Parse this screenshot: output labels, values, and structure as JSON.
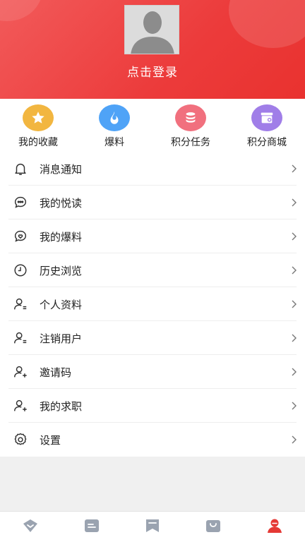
{
  "header": {
    "login_label": "点击登录",
    "bg_color": "#ec3b3b"
  },
  "quick_entries": [
    {
      "label": "我的收藏",
      "icon": "star-icon",
      "color": "#f0b33b"
    },
    {
      "label": "爆料",
      "icon": "flame-icon",
      "color": "#4a9ff5"
    },
    {
      "label": "积分任务",
      "icon": "coins-icon",
      "color": "#f16b7a"
    },
    {
      "label": "积分商城",
      "icon": "shop-icon",
      "color": "#9c7ce8"
    }
  ],
  "menu": [
    {
      "label": "消息通知",
      "icon": "bell-icon"
    },
    {
      "label": "我的悦读",
      "icon": "chat-bubble-icon"
    },
    {
      "label": "我的爆料",
      "icon": "heart-bubble-icon"
    },
    {
      "label": "历史浏览",
      "icon": "clock-icon"
    },
    {
      "label": "个人资料",
      "icon": "user-lines-icon"
    },
    {
      "label": "注销用户",
      "icon": "user-lines-icon"
    },
    {
      "label": "邀请码",
      "icon": "user-plus-icon"
    },
    {
      "label": "我的求职",
      "icon": "user-plus-icon"
    },
    {
      "label": "设置",
      "icon": "gear-icon"
    }
  ],
  "tabbar": {
    "items": [
      "home-icon",
      "news-icon",
      "bookmark-icon",
      "shop-bag-icon",
      "profile-icon"
    ],
    "active_index": 4,
    "active_color": "#e53935",
    "inactive_color": "#9aa3b0"
  }
}
